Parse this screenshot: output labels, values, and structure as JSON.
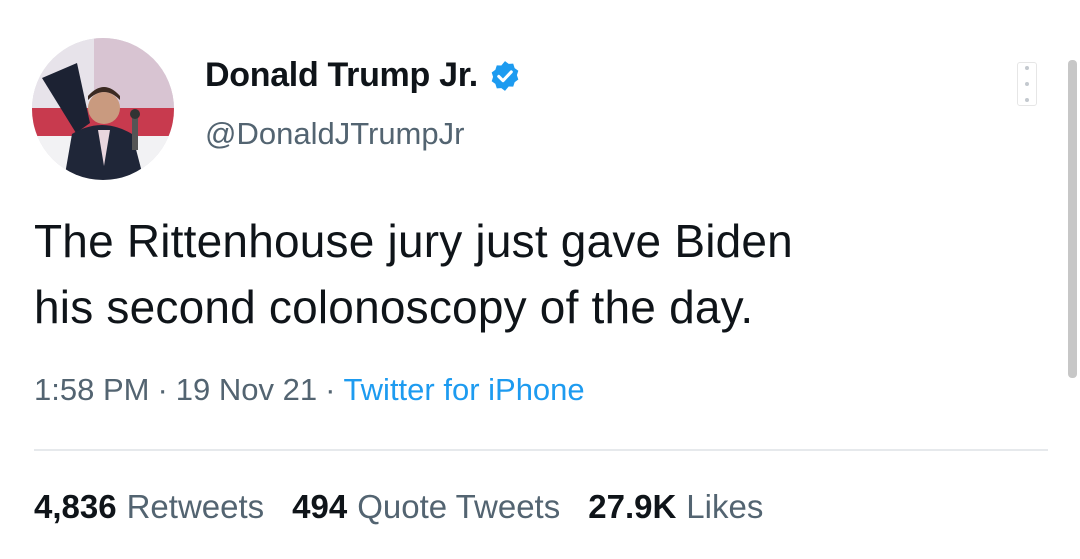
{
  "tweet": {
    "author": {
      "display_name": "Donald Trump Jr.",
      "handle": "@DonaldJTrumpJr",
      "verified_icon": "verified-badge-icon"
    },
    "text_lines": [
      "The Rittenhouse jury just gave Biden",
      "his second colonoscopy of the day."
    ],
    "meta": {
      "time": "1:58 PM",
      "date": "19 Nov 21",
      "separator": "·",
      "source": "Twitter for iPhone"
    },
    "stats": [
      {
        "value": "4,836",
        "label": "Retweets"
      },
      {
        "value": "494",
        "label": "Quote Tweets"
      },
      {
        "value": "27.9K",
        "label": "Likes"
      }
    ]
  },
  "colors": {
    "text_primary": "#0f1419",
    "text_secondary": "#536471",
    "accent": "#1d9bf0"
  },
  "icons": {
    "more": "more-options-icon"
  }
}
